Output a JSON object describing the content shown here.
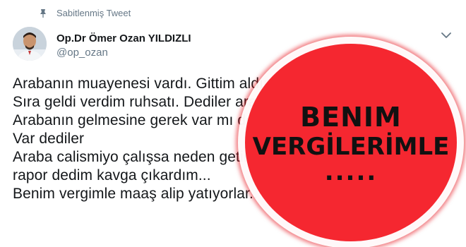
{
  "pinned": {
    "label": "Sabitlenmiş Tweet",
    "icon": "pin-icon"
  },
  "author": {
    "display_name": "Op.Dr Ömer Ozan YILDIZLI",
    "handle": "@op_ozan"
  },
  "menu": {
    "icon": "chevron-down-icon"
  },
  "tweet_lines": [
    "Arabanın muayenesi vardı. Gittim aldım sıramı bekledim",
    "Sıra geldi verdim ruhsatı. Dediler araba nerde?",
    "Arabanın gelmesine gerek var mı dedim",
    "Var dediler",
    "Araba calismiyo çalışsa neden getirmeyim vereceğiniz bir",
    "rapor dedim kavga çıkardım...",
    "Benim vergimle maaş alip yatıyorlar.."
  ],
  "stamp": {
    "line1": "BENIM",
    "line2": "VERGİLERİMLE",
    "line3": ".....",
    "color": "#f52730"
  },
  "colors": {
    "text": "#14171a",
    "secondary": "#657786"
  }
}
